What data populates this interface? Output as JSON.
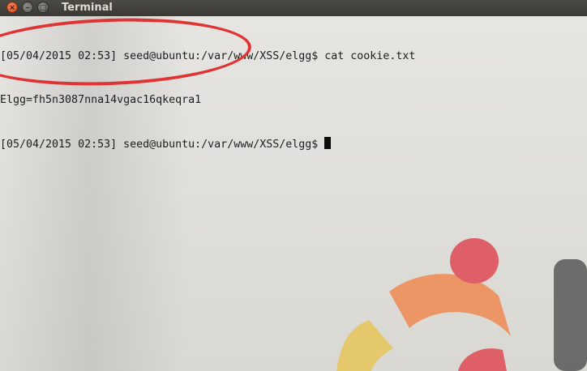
{
  "window": {
    "title": "Terminal",
    "close_glyph": "×",
    "minimize_glyph": "–",
    "maximize_glyph": "□"
  },
  "terminal": {
    "lines": [
      "[05/04/2015 02:53] seed@ubuntu:/var/www/XSS/elgg$ cat cookie.txt",
      "Elgg=fh5n3087nna14vgac16qkeqra1",
      "[05/04/2015 02:53] seed@ubuntu:/var/www/XSS/elgg$ "
    ]
  },
  "annotation": {
    "color": "#e03434",
    "shape": "ellipse"
  },
  "wallpaper": {
    "colors": [
      "#e04a55",
      "#ef8a52",
      "#e8c55a",
      "#555555"
    ]
  }
}
